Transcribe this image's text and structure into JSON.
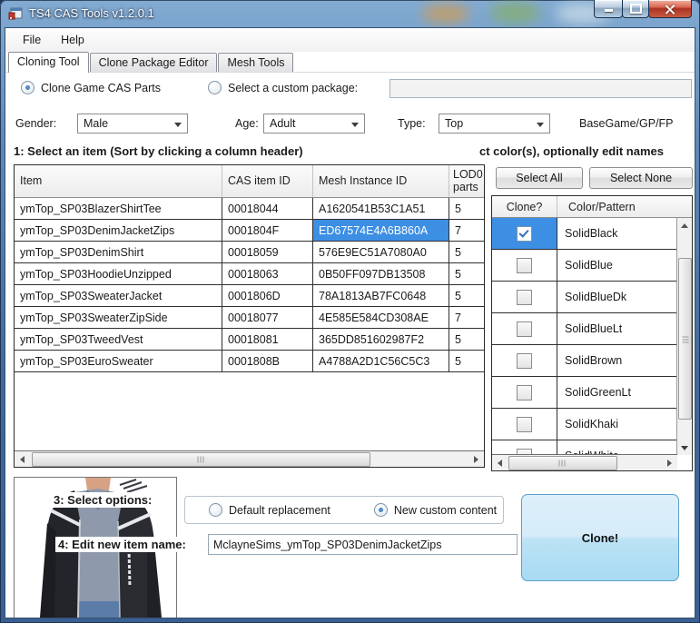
{
  "window": {
    "title": "TS4 CAS Tools v1.2.0.1",
    "buttons": {
      "minimize": "minimize",
      "maximize": "maximize",
      "close": "close"
    }
  },
  "menu": {
    "file": "File",
    "help": "Help"
  },
  "tabs": {
    "cloning": "Cloning Tool",
    "package_editor": "Clone Package Editor",
    "mesh": "Mesh Tools",
    "active": "Cloning Tool"
  },
  "source": {
    "clone_game_label": "Clone Game CAS Parts",
    "custom_package_label": "Select a custom package:",
    "custom_package_value": "",
    "selected": "clone_game"
  },
  "filters": {
    "gender_label": "Gender:",
    "gender_value": "Male",
    "age_label": "Age:",
    "age_value": "Adult",
    "type_label": "Type:",
    "type_value": "Top",
    "pack_label": "BaseGame/GP/FP"
  },
  "step1_heading": "1: Select an item (Sort by clicking a column header)",
  "step2_heading": "ct color(s), optionally edit names",
  "items": {
    "columns": {
      "item": "Item",
      "cas_id": "CAS item ID",
      "mesh_id": "Mesh Instance ID",
      "lod0": "LOD0 parts"
    },
    "rows": [
      {
        "item": "ymTop_SP03BlazerShirtTee",
        "cas_id": "00018044",
        "mesh_id": "A1620541B53C1A51",
        "lod0": "5"
      },
      {
        "item": "ymTop_SP03DenimJacketZips",
        "cas_id": "0001804F",
        "mesh_id": "ED67574E4A6B860A",
        "lod0": "7"
      },
      {
        "item": "ymTop_SP03DenimShirt",
        "cas_id": "00018059",
        "mesh_id": "576E9EC51A7080A0",
        "lod0": "5"
      },
      {
        "item": "ymTop_SP03HoodieUnzipped",
        "cas_id": "00018063",
        "mesh_id": "0B50FF097DB13508",
        "lod0": "5"
      },
      {
        "item": "ymTop_SP03SweaterJacket",
        "cas_id": "0001806D",
        "mesh_id": "78A1813AB7FC0648",
        "lod0": "5"
      },
      {
        "item": "ymTop_SP03SweaterZipSide",
        "cas_id": "00018077",
        "mesh_id": "4E585E584CD308AE",
        "lod0": "7"
      },
      {
        "item": "ymTop_SP03TweedVest",
        "cas_id": "00018081",
        "mesh_id": "365DD851602987F2",
        "lod0": "5"
      },
      {
        "item": "ymTop_SP03EuroSweater",
        "cas_id": "0001808B",
        "mesh_id": "A4788A2D1C56C5C3",
        "lod0": "5"
      }
    ],
    "selected": {
      "row": 1,
      "column": "mesh_id"
    }
  },
  "colors_panel": {
    "select_all": "Select All",
    "select_none": "Select None",
    "columns": {
      "clone": "Clone?",
      "color": "Color/Pattern"
    },
    "rows": [
      {
        "name": "SolidBlack",
        "checked": true,
        "highlighted": true
      },
      {
        "name": "SolidBlue",
        "checked": false,
        "highlighted": false
      },
      {
        "name": "SolidBlueDk",
        "checked": false,
        "highlighted": false
      },
      {
        "name": "SolidBlueLt",
        "checked": false,
        "highlighted": false
      },
      {
        "name": "SolidBrown",
        "checked": false,
        "highlighted": false
      },
      {
        "name": "SolidGreenLt",
        "checked": false,
        "highlighted": false
      },
      {
        "name": "SolidKhaki",
        "checked": false,
        "highlighted": false
      },
      {
        "name": "SolidWhite",
        "checked": false,
        "highlighted": false
      }
    ]
  },
  "options": {
    "step3_heading": "3: Select options:",
    "default_replacement": "Default replacement",
    "new_custom_content": "New custom content",
    "selected": "new_custom_content"
  },
  "naming": {
    "step4_heading": "4: Edit new item name:",
    "name_value": "MclayneSims_ymTop_SP03DenimJacketZips"
  },
  "clone_button_label": "Clone!",
  "theme": {
    "selection_blue": "#3d8fe4",
    "titlebar_blue": "#5d8ab8",
    "close_red": "#ac3323",
    "clone_button_top": "#dceffa",
    "clone_button_bottom": "#a8daf2",
    "clone_button_border": "#5ba0cd"
  }
}
